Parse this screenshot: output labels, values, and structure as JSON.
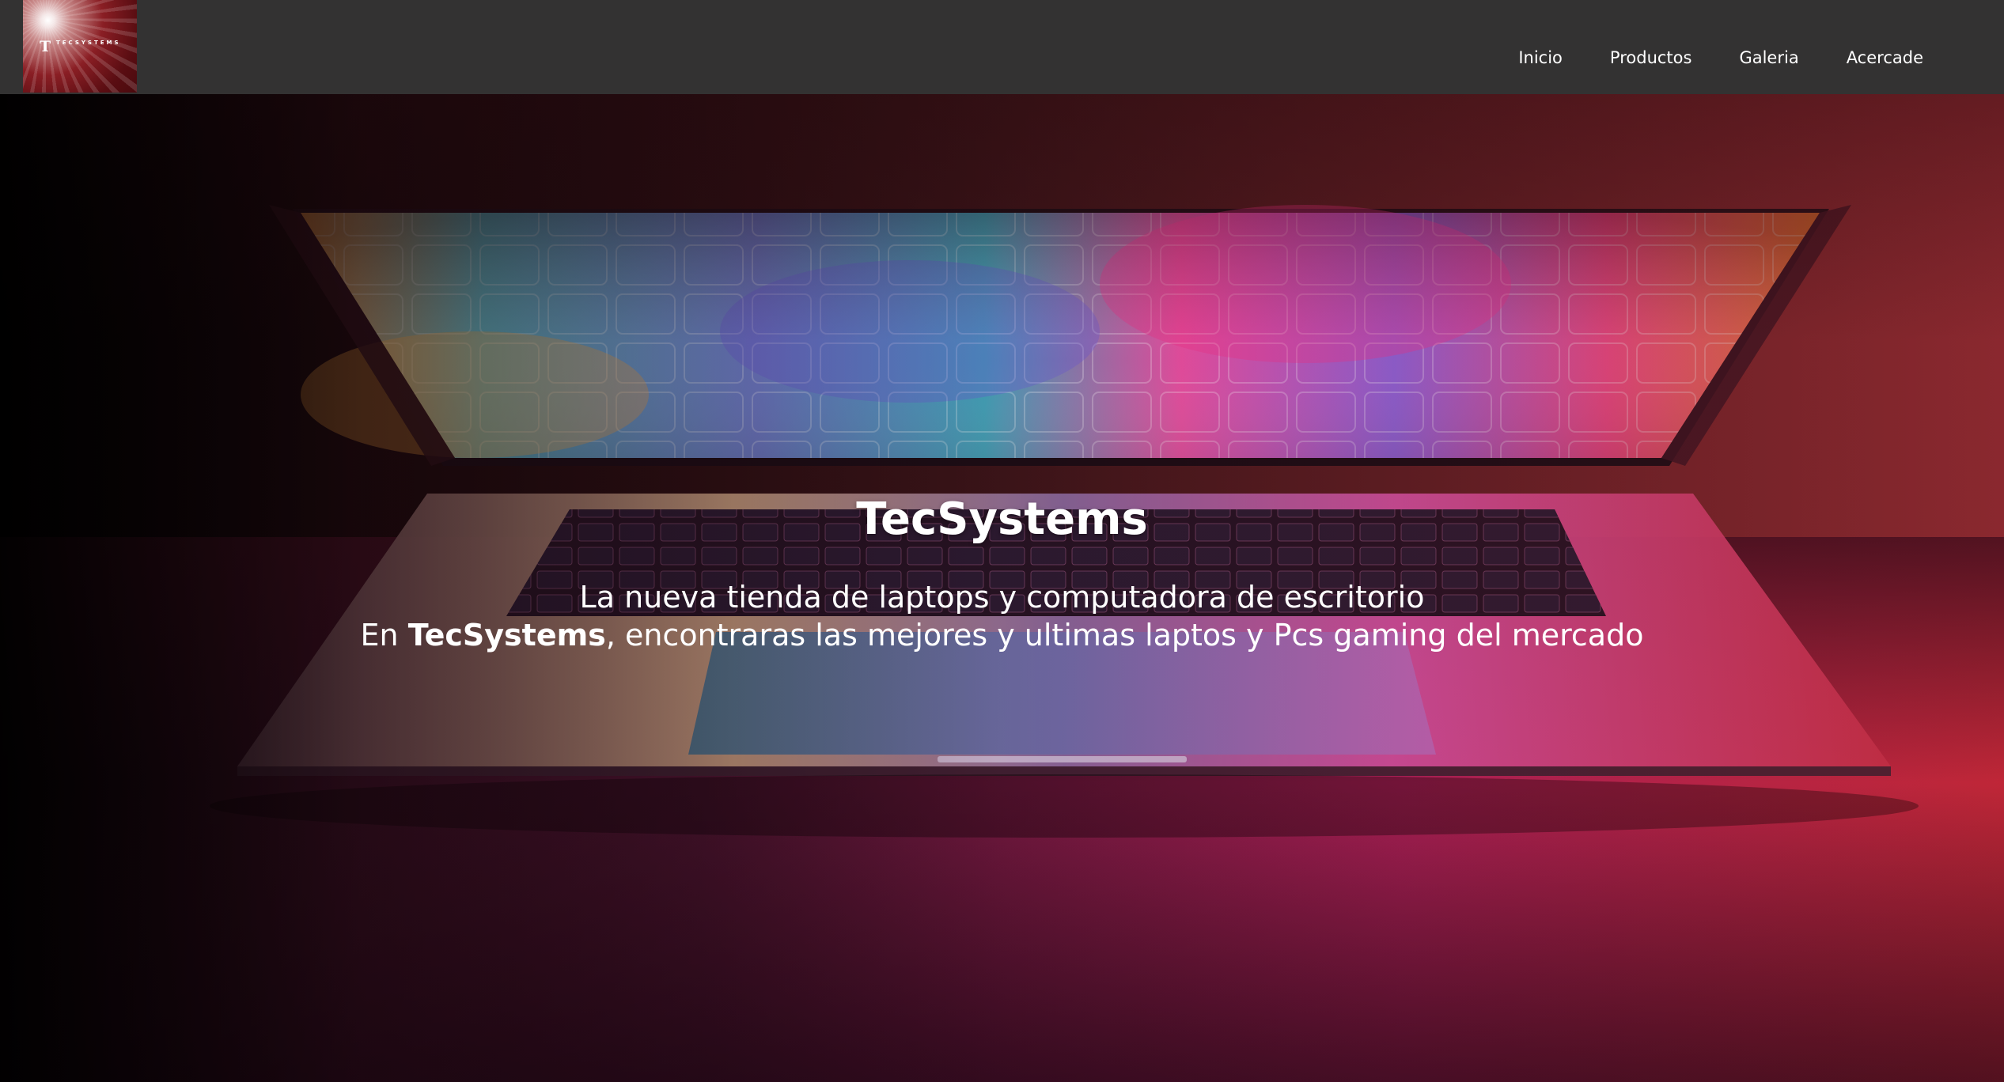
{
  "brand": {
    "logo_mark": "T",
    "logo_text": "TECSYSTEMS"
  },
  "nav": {
    "items": [
      {
        "label": "Inicio"
      },
      {
        "label": "Productos"
      },
      {
        "label": "Galeria"
      },
      {
        "label": "Acercade"
      }
    ]
  },
  "hero": {
    "title": "TecSystems",
    "subtitle_line1": "La nueva tienda de laptops y computadora de escritorio",
    "subtitle_line2_prefix": "En ",
    "subtitle_line2_brand": "TecSystems",
    "subtitle_line2_suffix": ", encontraras las mejores y ultimas laptos y Pcs gaming del mercado"
  },
  "colors": {
    "navbar": "#333232",
    "nav_text": "#ffffff",
    "logo_red": "#8a1e24",
    "hero_pink": "#e0287a",
    "hero_red": "#c8283a"
  }
}
